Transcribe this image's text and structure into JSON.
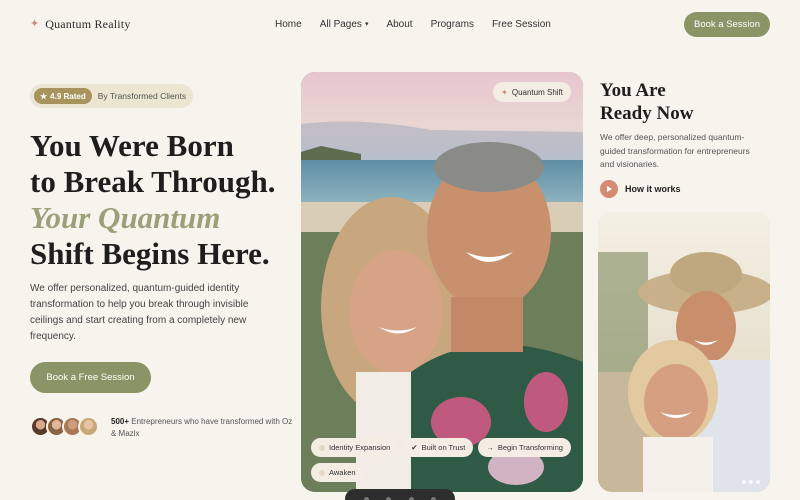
{
  "brand": {
    "name": "Quantum Reality",
    "mark": "✦"
  },
  "nav": {
    "items": [
      "Home",
      "All Pages",
      "About",
      "Programs",
      "Free Session"
    ],
    "dropdown_caret": "▾",
    "cta": "Book a Session"
  },
  "hero": {
    "rating_value": "4.9 Rated",
    "rating_star": "★",
    "rating_label": "By Transformed Clients",
    "title_lines": [
      "You Were Born",
      "to Break Through."
    ],
    "title_accent": "Your Quantum",
    "title_last": "Shift Begins Here.",
    "lead": "We offer personalized, quantum-guided identity transformation to help you break through invisible ceilings and start creating from a completely new frequency.",
    "cta": "Book a Free Session",
    "proof_count": "500+",
    "proof_text": "Entrepreneurs who have transformed with Oz & Mazlx"
  },
  "photo_card": {
    "tag": "Quantum Shift",
    "tag_icon": "✦",
    "chips": [
      {
        "icon": "",
        "label": "Identity Expansion"
      },
      {
        "icon": "✔",
        "label": "Built on Trust"
      },
      {
        "icon": "→",
        "label": "Begin Transforming"
      },
      {
        "icon": "",
        "label": "Awaken"
      }
    ]
  },
  "side": {
    "title_line1": "You Are",
    "title_line2": "Ready Now",
    "desc": "We offer deep, personalized quantum-guided transformation for entrepreneurs and visionaries.",
    "how": "How it works"
  },
  "colors": {
    "accent": "#8b9466",
    "accent_text": "#9aa17a",
    "rating_pill": "#a8935c",
    "play": "#d58a72",
    "background": "#f7f4ee"
  }
}
